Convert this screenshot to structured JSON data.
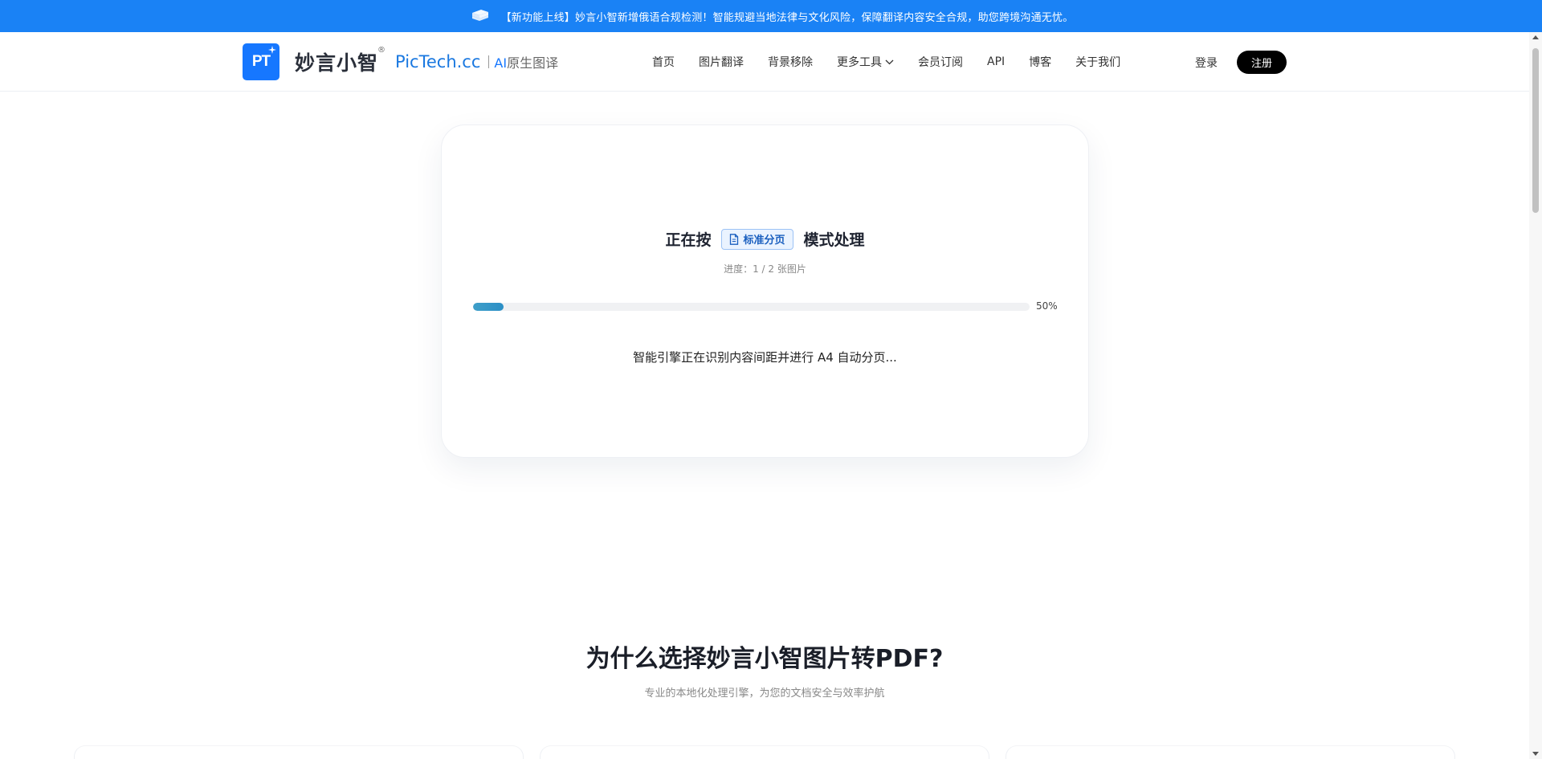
{
  "banner": {
    "text": "【新功能上线】妙言小智新增俄语合规检测！智能规避当地法律与文化风险，保障翻译内容安全合规，助您跨境沟通无忧。",
    "icon": "book-stack-icon"
  },
  "header": {
    "logo_mark": "PT",
    "logo_cn": "妙言小智",
    "logo_reg": "®",
    "logo_en": "PicTech.cc",
    "logo_tag_ai": "AI",
    "logo_tag_rest": "原生图译",
    "nav": [
      "首页",
      "图片翻译",
      "背景移除",
      "更多工具",
      "会员订阅",
      "API",
      "博客",
      "关于我们"
    ],
    "login": "登录",
    "register": "注册"
  },
  "processing": {
    "title_prefix": "正在按",
    "mode": "标准分页",
    "title_suffix": "模式处理",
    "progress_text": "进度：1 / 2 张图片",
    "progress_fraction": 0.055,
    "percent_label": "50%",
    "status": "智能引擎正在识别内容间距并进行 A4 自动分页..."
  },
  "why": {
    "title": "为什么选择妙言小智图片转PDF?",
    "subtitle": "专业的本地化处理引擎，为您的文档安全与效率护航"
  },
  "colors": {
    "banner_bg": "#1a82f5",
    "brand_blue": "#1677ff",
    "progress": "#2b8fc6",
    "register_bg": "#000000"
  }
}
